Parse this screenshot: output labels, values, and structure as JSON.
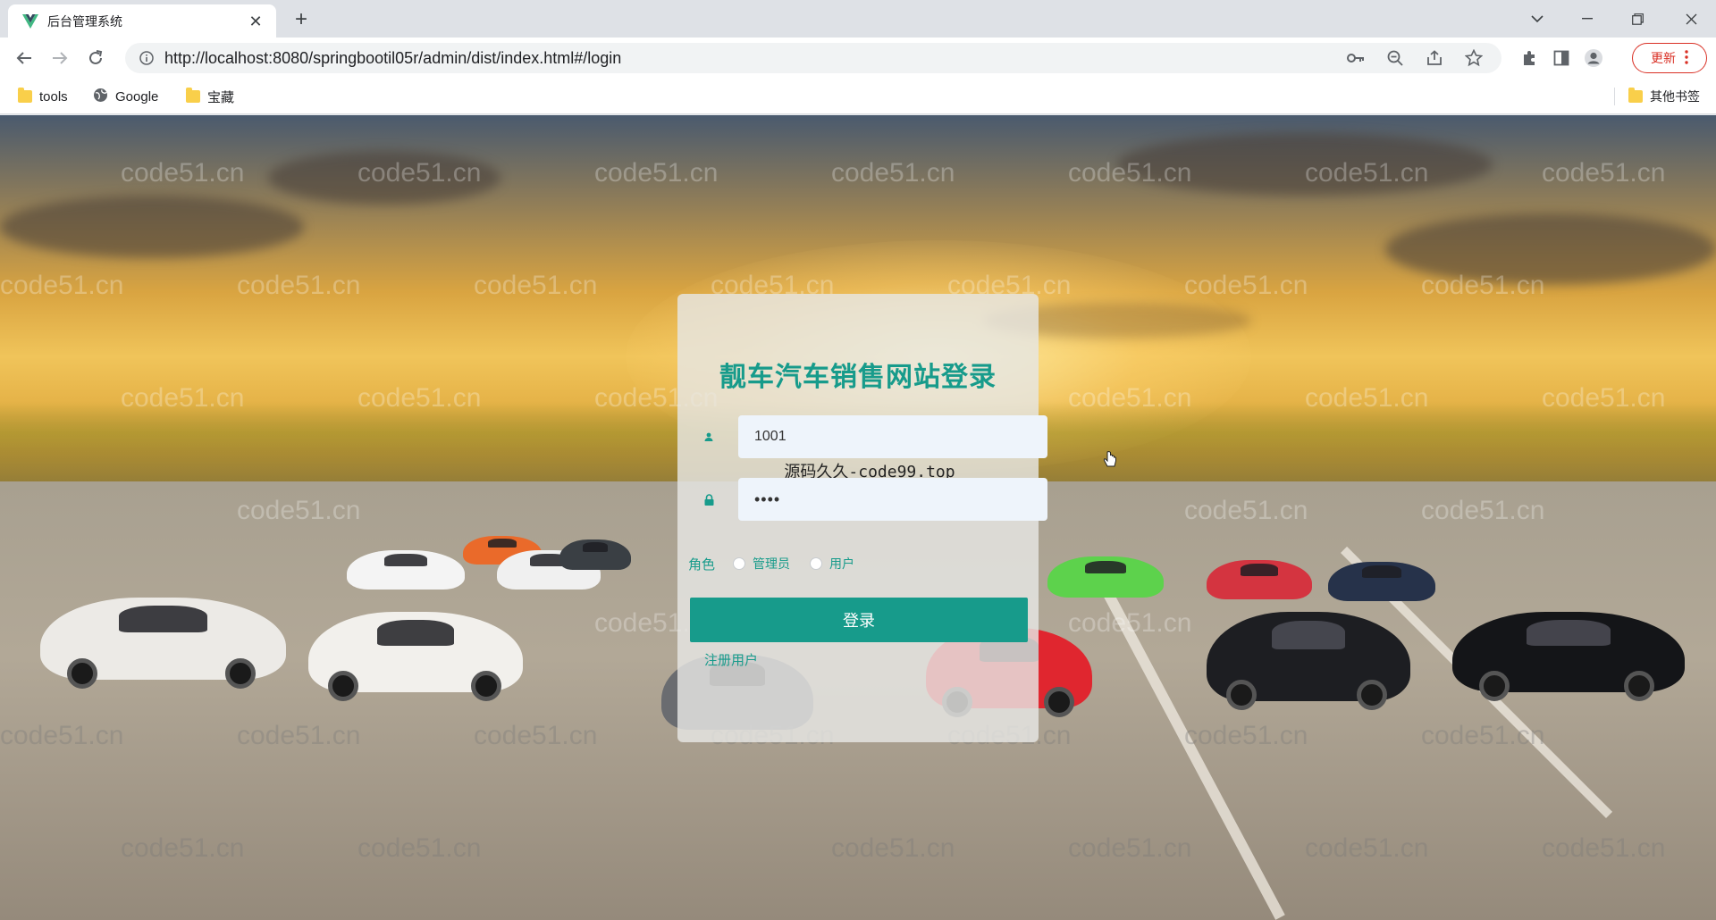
{
  "browser": {
    "tab_title": "后台管理系统",
    "tab_close": "✕",
    "new_tab": "+",
    "url": "http://localhost:8080/springbootil05r/admin/dist/index.html#/login",
    "update_label": "更新",
    "window_controls": [
      "chevron-down",
      "minimize",
      "restore",
      "close"
    ]
  },
  "bookmarks": {
    "items": [
      {
        "label": "tools",
        "icon": "folder-icon"
      },
      {
        "label": "Google",
        "icon": "globe-icon"
      },
      {
        "label": "宝藏",
        "icon": "folder-icon"
      }
    ],
    "other": "其他书签"
  },
  "watermark": "code51.cn",
  "login": {
    "title": "靓车汽车销售网站登录",
    "username_value": "1001",
    "password_value": "••••",
    "overlay_text": "源码久久-code99.top",
    "role_label": "角色",
    "role_options": [
      "管理员",
      "用户"
    ],
    "submit_label": "登录",
    "register_label": "注册用户"
  },
  "colors": {
    "accent": "#179b8b",
    "update_red": "#d93025"
  }
}
